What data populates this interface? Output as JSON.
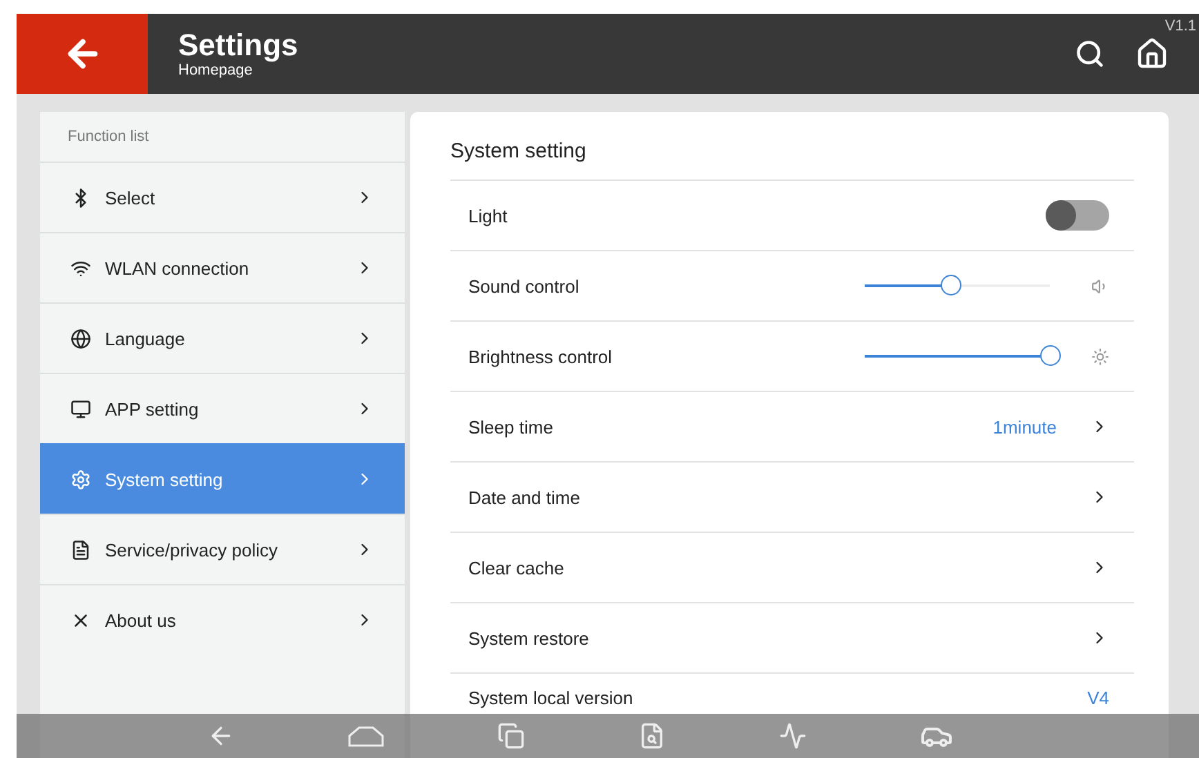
{
  "header": {
    "title": "Settings",
    "subtitle": "Homepage",
    "version": "V1.1"
  },
  "sidebar": {
    "heading": "Function list",
    "items": [
      {
        "label": "Select",
        "selected": false
      },
      {
        "label": "WLAN connection",
        "selected": false
      },
      {
        "label": "Language",
        "selected": false
      },
      {
        "label": "APP setting",
        "selected": false
      },
      {
        "label": "System setting",
        "selected": true
      },
      {
        "label": "Service/privacy policy",
        "selected": false
      },
      {
        "label": "About us",
        "selected": false
      }
    ]
  },
  "panel": {
    "title": "System setting",
    "rows": [
      {
        "kind": "toggle",
        "label": "Light",
        "on": false
      },
      {
        "kind": "slider",
        "label": "Sound control",
        "level": 0.46
      },
      {
        "kind": "slider",
        "label": "Brightness control",
        "level": 1
      },
      {
        "kind": "value",
        "label": "Sleep time",
        "value": "1minute"
      },
      {
        "kind": "link",
        "label": "Date and time"
      },
      {
        "kind": "link",
        "label": "Clear cache"
      },
      {
        "kind": "link",
        "label": "System restore"
      },
      {
        "kind": "info",
        "label": "System local version",
        "value": "V4"
      }
    ]
  }
}
